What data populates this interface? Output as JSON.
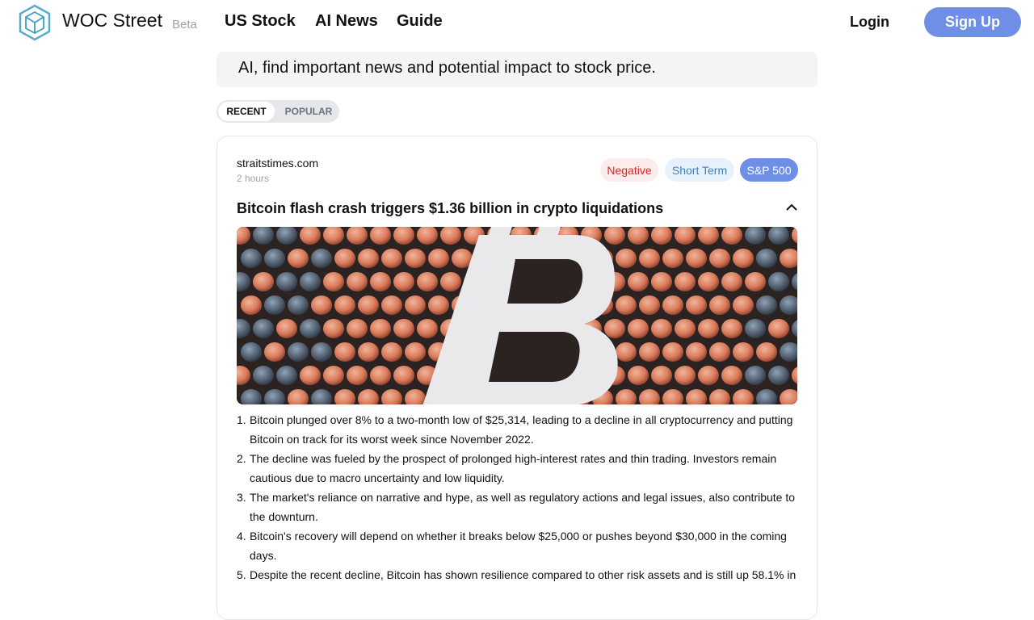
{
  "header": {
    "brand": "WOC Street",
    "beta": "Beta",
    "nav": [
      "US Stock",
      "AI News",
      "Guide"
    ],
    "login": "Login",
    "signup": "Sign Up"
  },
  "banner": {
    "text": "AI, find important news and potential impact to stock price."
  },
  "tabs": {
    "recent": "RECENT",
    "popular": "POPULAR"
  },
  "article": {
    "source": "straitstimes.com",
    "time": "2 hours",
    "tags": {
      "sentiment": "Negative",
      "term": "Short Term",
      "index": "S&P 500"
    },
    "title": "Bitcoin flash crash triggers $1.36 billion in crypto liquidations",
    "image": {
      "icon": "bitcoin-symbol",
      "background": "copper-discs"
    },
    "summary": [
      {
        "num": "1.",
        "text": "Bitcoin plunged over 8% to a two-month low of $25,314, leading to a decline in all cryptocurrency and putting Bitcoin on track for its worst week since November 2022."
      },
      {
        "num": "2.",
        "text": "The decline was fueled by the prospect of prolonged high-interest rates and thin trading. Investors remain cautious due to macro uncertainty and low liquidity."
      },
      {
        "num": "3.",
        "text": "The market's reliance on narrative and hype, as well as regulatory actions and legal issues, also contribute to the downturn."
      },
      {
        "num": "4.",
        "text": "Bitcoin's recovery will depend on whether it breaks below $25,000 or pushes beyond $30,000 in the coming days."
      },
      {
        "num": "5.",
        "text": "Despite the recent decline, Bitcoin has shown resilience compared to other risk assets and is still up 58.1% in"
      }
    ]
  },
  "colors": {
    "accent": "#6f8fe6",
    "negative": "#dc2626",
    "term": "#3b82c4"
  }
}
